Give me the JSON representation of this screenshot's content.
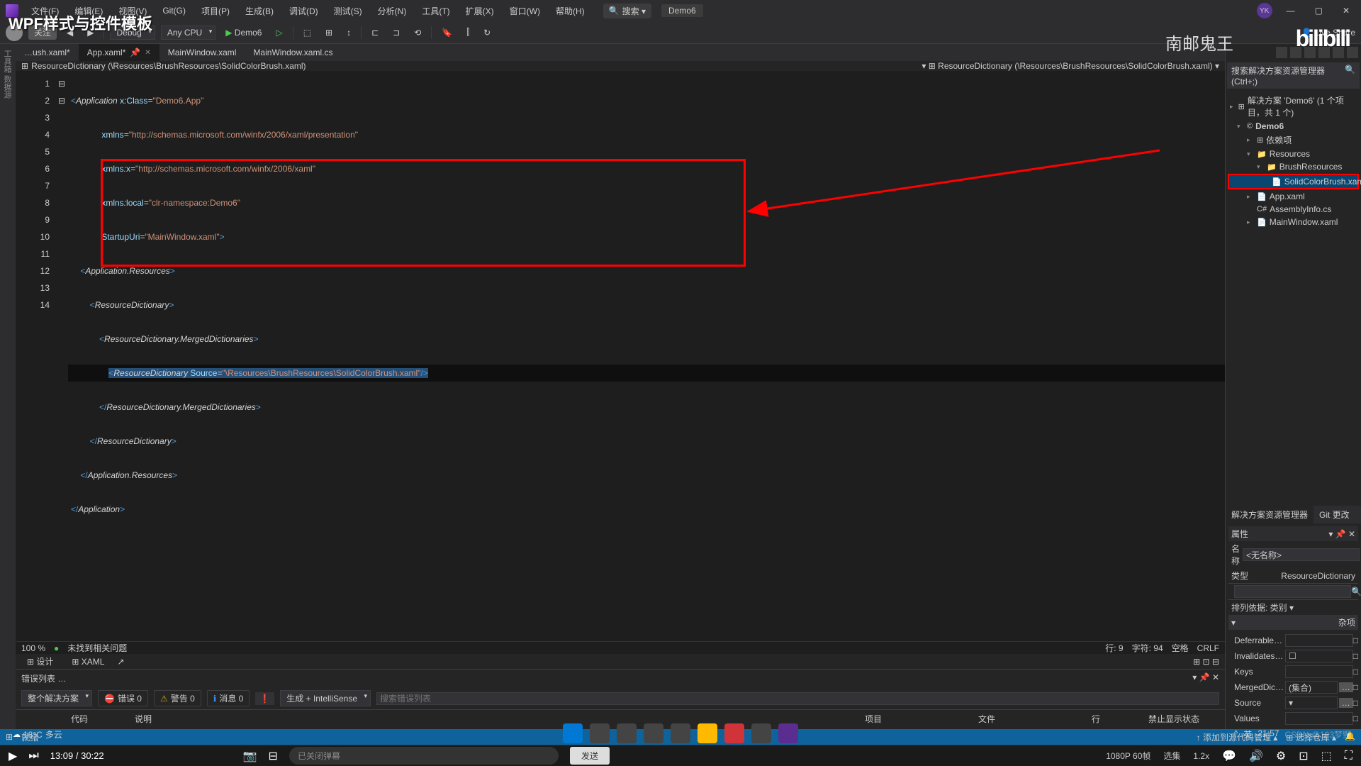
{
  "title_overlay": "WPF样式与控件模板",
  "menu": [
    "文件(F)",
    "编辑(E)",
    "视图(V)",
    "Git(G)",
    "项目(P)",
    "生成(B)",
    "调试(D)",
    "测试(S)",
    "分析(N)",
    "工具(T)",
    "扩展(X)",
    "窗口(W)",
    "帮助(H)"
  ],
  "search": "搜索 ▾",
  "project_tag": "Demo6",
  "user_initials": "YK",
  "follow_btn": "关注",
  "toolbar": {
    "config": "Debug",
    "platform": "Any CPU",
    "run": "Demo6",
    "live_share": "Live Share"
  },
  "file_tabs": [
    {
      "name": "…ush.xaml*",
      "active": false
    },
    {
      "name": "App.xaml*",
      "active": true
    },
    {
      "name": "MainWindow.xaml",
      "active": false
    },
    {
      "name": "MainWindow.xaml.cs",
      "active": false
    }
  ],
  "breadcrumb_left": "ResourceDictionary (\\Resources\\BrushResources\\SolidColorBrush.xaml)",
  "breadcrumb_right": "ResourceDictionary (\\Resources\\BrushResources\\SolidColorBrush.xaml)",
  "line_numbers": [
    "1",
    "2",
    "3",
    "4",
    "5",
    "6",
    "7",
    "8",
    "9",
    "10",
    "11",
    "12",
    "13",
    "14"
  ],
  "editor_status": {
    "zoom": "100 %",
    "issues": "未找到相关问题",
    "design": "设计",
    "xaml": "XAML",
    "ln": "行: 9",
    "ch": "字符: 94",
    "sp": "空格",
    "crlf": "CRLF"
  },
  "error_panel": {
    "title": "错误列表 …",
    "scope": "整个解决方案",
    "errors": "错误 0",
    "warnings": "警告 0",
    "messages": "消息 0",
    "build": "生成 + IntelliSense",
    "search": "搜索错误列表",
    "cols": [
      "",
      "代码",
      "说明",
      "项目",
      "文件",
      "行",
      "禁止显示状态"
    ]
  },
  "solution": {
    "search": "搜索解决方案资源管理器(Ctrl+;)",
    "root": "解决方案 'Demo6' (1 个项目，共 1 个)",
    "items": {
      "project": "Demo6",
      "deps": "依赖项",
      "resources": "Resources",
      "brush": "BrushResources",
      "solid": "SolidColorBrush.xaml",
      "app": "App.xaml",
      "assembly": "AssemblyInfo.cs",
      "mainwin": "MainWindow.xaml"
    }
  },
  "panel_tabs": [
    "解决方案资源管理器",
    "Git 更改"
  ],
  "properties": {
    "title": "属性",
    "name_lbl": "名称",
    "name_val": "<无名称>",
    "type_lbl": "类型",
    "type_val": "ResourceDictionary",
    "sort": "排列依据: 类别 ▾",
    "group": "杂项",
    "rows": [
      {
        "lbl": "DeferrableC…",
        "val": ""
      },
      {
        "lbl": "InvalidatesI…",
        "val": "☐"
      },
      {
        "lbl": "Keys",
        "val": ""
      },
      {
        "lbl": "MergedDicti…",
        "val": "(集合)",
        "btn": "…"
      },
      {
        "lbl": "Source",
        "val": "",
        "btn": "…"
      },
      {
        "lbl": "Values",
        "val": ""
      }
    ]
  },
  "statusbar": {
    "ready": "就绪",
    "add": "添加到源代码管理 ▴",
    "repo": "选择仓库 ▴"
  },
  "video": {
    "time": "13:09 / 30:22",
    "danmu": "已关闭弹幕",
    "send": "发送",
    "quality": "1080P 60帧",
    "episodes": "选集",
    "speed": "1.2x"
  },
  "weather": {
    "temp": "18°C",
    "desc": "多云"
  },
  "tray_time": "21:57",
  "csdn": "CSDN @123梦野",
  "watermark": {
    "brand": "bilibili",
    "author": "南邮鬼王"
  }
}
